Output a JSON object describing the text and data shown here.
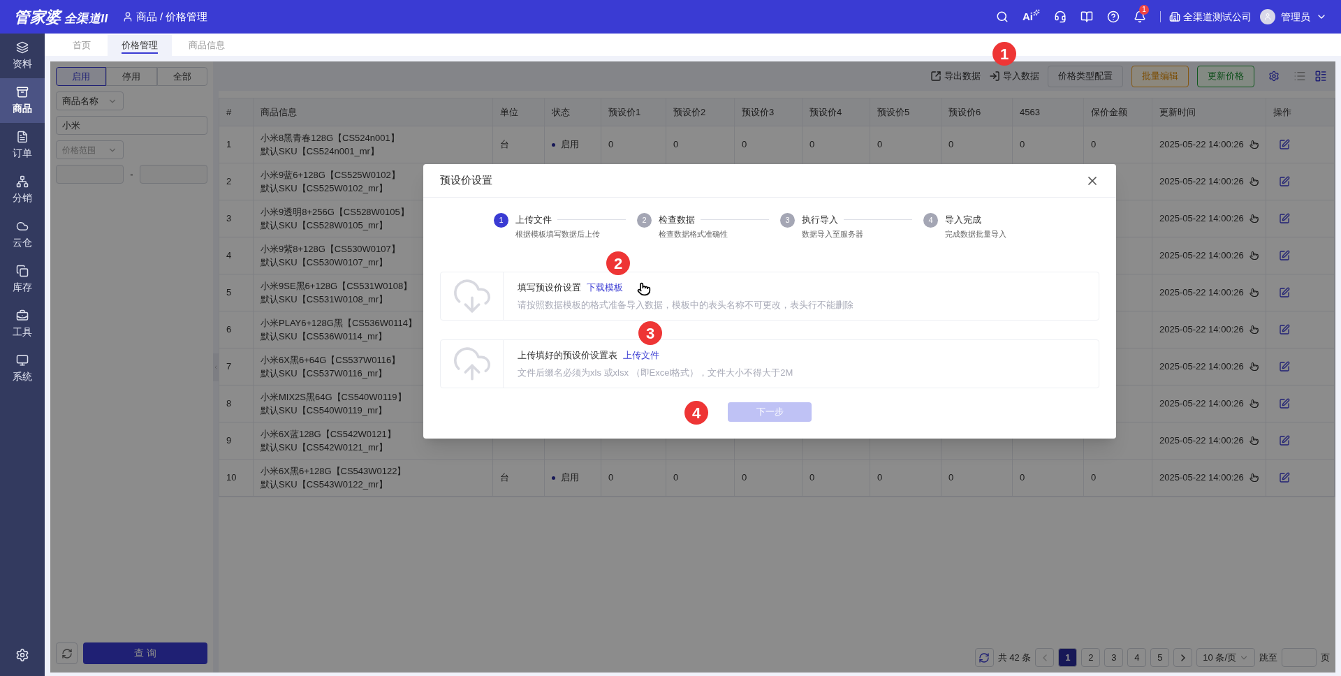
{
  "header": {
    "logo": "管家婆",
    "logo_suffix": "全渠道II",
    "breadcrumb": "商品 / 价格管理",
    "ai_label": "Ai",
    "notification_count": "1",
    "company": "全渠道测试公司",
    "user": "管理员"
  },
  "sidebar": {
    "items": [
      {
        "label": "资料",
        "selected": false
      },
      {
        "label": "商品",
        "selected": true
      },
      {
        "label": "订单",
        "selected": false
      },
      {
        "label": "分销",
        "selected": false
      },
      {
        "label": "云仓",
        "selected": false
      },
      {
        "label": "库存",
        "selected": false
      },
      {
        "label": "工具",
        "selected": false
      },
      {
        "label": "系统",
        "selected": false
      }
    ]
  },
  "tabs": [
    {
      "label": "首页",
      "selected": false
    },
    {
      "label": "价格管理",
      "selected": true
    },
    {
      "label": "商品信息",
      "selected": false
    }
  ],
  "filter": {
    "status_options": [
      {
        "label": "启用",
        "selected": true
      },
      {
        "label": "停用",
        "selected": false
      },
      {
        "label": "全部",
        "selected": false
      }
    ],
    "field_select": "商品名称",
    "keyword": "小米",
    "range_select": {
      "placeholder": "价格范围"
    },
    "range_separator": "-",
    "query_button": "查 询"
  },
  "toolbar": {
    "links": [
      {
        "label": "导出数据",
        "kind": "export"
      },
      {
        "label": "导入数据",
        "kind": "import"
      }
    ],
    "buttons": [
      {
        "label": "价格类型配置",
        "kind": "plain"
      },
      {
        "label": "批量编辑",
        "kind": "warning"
      },
      {
        "label": "更新价格",
        "kind": "success"
      }
    ],
    "view_toggle": [
      {
        "kind": "list",
        "selected": false
      },
      {
        "kind": "cards",
        "selected": true
      }
    ]
  },
  "table": {
    "columns": [
      "#",
      "商品信息",
      "单位",
      "状态",
      "预设价1",
      "预设价2",
      "预设价3",
      "预设价4",
      "预设价5",
      "预设价6",
      "4563",
      "保价金额",
      "更新时间",
      "操作"
    ],
    "rows": [
      {
        "index": "1",
        "name": "小米8黑青春128G【CS524n001】",
        "sku": "默认SKU【CS524n001_mr】",
        "unit": "台",
        "status": "启用",
        "prices": [
          "0",
          "0",
          "0",
          "0",
          "0",
          "0",
          "0",
          "0"
        ],
        "updated": "2025-05-22 14:00:26"
      },
      {
        "index": "2",
        "name": "小米9蓝6+128G【CS525W0102】",
        "sku": "默认SKU【CS525W0102_mr】",
        "updated": "2025-05-22 14:00:26"
      },
      {
        "index": "3",
        "name": "小米9透明8+256G【CS528W0105】",
        "sku": "默认SKU【CS528W0105_mr】",
        "updated": "2025-05-22 14:00:26"
      },
      {
        "index": "4",
        "name": "小米9紫8+128G【CS530W0107】",
        "sku": "默认SKU【CS530W0107_mr】",
        "updated": "2025-05-22 14:00:26"
      },
      {
        "index": "5",
        "name": "小米9SE黑6+128G【CS531W0108】",
        "sku": "默认SKU【CS531W0108_mr】",
        "updated": "2025-05-22 14:00:26"
      },
      {
        "index": "6",
        "name": "小米PLAY6+128G黑【CS536W0114】",
        "sku": "默认SKU【CS536W0114_mr】",
        "updated": "2025-05-22 14:00:26"
      },
      {
        "index": "7",
        "name": "小米6X黑6+64G【CS537W0116】",
        "sku": "默认SKU【CS537W0116_mr】",
        "updated": "2025-05-22 14:00:26"
      },
      {
        "index": "8",
        "name": "小米MIX2S黑64G【CS540W0119】",
        "sku": "默认SKU【CS540W0119_mr】",
        "updated": "2025-05-22 14:00:26"
      },
      {
        "index": "9",
        "name": "小米6X蓝128G【CS542W0121】",
        "sku": "默认SKU【CS542W0121_mr】",
        "updated": "2025-05-22 14:00:26"
      },
      {
        "index": "10",
        "name": "小米6X黑6+128G【CS543W0122】",
        "sku": "默认SKU【CS543W0122_mr】",
        "unit": "台",
        "status": "启用",
        "prices": [
          "0",
          "0",
          "0",
          "0",
          "0",
          "0",
          "0",
          "0"
        ],
        "updated": "2025-05-22 14:00:26"
      }
    ]
  },
  "pagination": {
    "total": "共 42 条",
    "pages": [
      {
        "label": "1",
        "selected": true
      },
      {
        "label": "2",
        "selected": false
      },
      {
        "label": "3",
        "selected": false
      },
      {
        "label": "4",
        "selected": false
      },
      {
        "label": "5",
        "selected": false
      }
    ],
    "page_size": "10 条/页",
    "jump_label": "跳至",
    "page_suffix": "页"
  },
  "dialog": {
    "title": "预设价设置",
    "steps": [
      {
        "number": "1",
        "title": "上传文件",
        "description": "根据模板填写数据后上传",
        "selected": true
      },
      {
        "number": "2",
        "title": "检查数据",
        "description": "检查数据格式准确性",
        "selected": false
      },
      {
        "number": "3",
        "title": "执行导入",
        "description": "数据导入至服务器",
        "selected": false
      },
      {
        "number": "4",
        "title": "导入完成",
        "description": "完成数据批量导入",
        "selected": false
      }
    ],
    "sections": [
      {
        "kind": "download",
        "title": "填写预设价设置",
        "link": "下载模板",
        "description": "请按照数据模板的格式准备导入数据，模板中的表头名称不可更改，表头行不能删除"
      },
      {
        "kind": "upload",
        "title": "上传填好的预设价设置表",
        "link": "上传文件",
        "description": "文件后缀名必须为xls 或xlsx （即Excel格式），文件大小不得大于2M"
      }
    ],
    "next_button": {
      "label": "下一步",
      "disabled": true
    }
  },
  "annotations": [
    "1",
    "2",
    "3",
    "4"
  ]
}
